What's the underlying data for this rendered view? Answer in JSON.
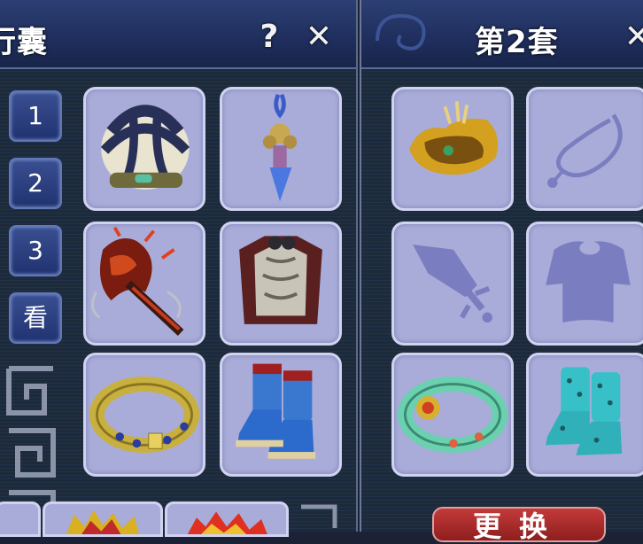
{
  "left_panel": {
    "title": "行囊",
    "help_label": "?",
    "close_label": "✕",
    "tabs": [
      "1",
      "2",
      "3",
      "看"
    ]
  },
  "right_panel": {
    "title": "第2套",
    "close_label": "✕",
    "action_label": "更换"
  },
  "items_left": [
    {
      "name": "striped-helmet-icon"
    },
    {
      "name": "blue-pendant-icon"
    },
    {
      "name": "flame-axe-icon"
    },
    {
      "name": "bone-armor-icon"
    },
    {
      "name": "gold-belt-icon"
    },
    {
      "name": "blue-boots-icon"
    }
  ],
  "items_right": [
    {
      "name": "gold-crown-icon"
    },
    {
      "name": "empty-necklace-slot-icon"
    },
    {
      "name": "empty-weapon-slot-icon"
    },
    {
      "name": "empty-armor-slot-icon"
    },
    {
      "name": "jade-belt-icon"
    },
    {
      "name": "teal-boots-icon"
    }
  ],
  "colors": {
    "slot_bg": "#a9acd8",
    "title_bar": "#1f2e5c",
    "action_button": "#a82a2a"
  }
}
